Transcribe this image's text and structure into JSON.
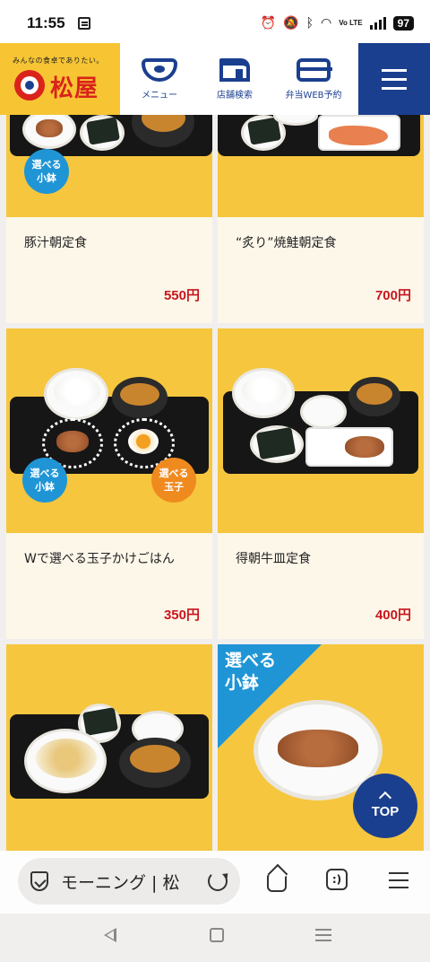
{
  "status_bar": {
    "time": "11:55",
    "battery": "97",
    "network": "Vo LTE"
  },
  "header": {
    "tagline": "みんなの食卓でありたい。",
    "logo_text": "松屋",
    "nav": [
      {
        "label": "メニュー",
        "icon": "bowl-icon"
      },
      {
        "label": "店舗検索",
        "icon": "store-icon"
      },
      {
        "label": "弁当WEB予約",
        "icon": "bento-box-icon"
      }
    ],
    "menu_icon": "hamburger-icon"
  },
  "products": [
    {
      "name": "豚汁朝定食",
      "price": "550円",
      "badge": "選べる\n小鉢"
    },
    {
      "name": "“炙り”焼鮭朝定食",
      "price": "700円"
    },
    {
      "name": "Wで選べる玉子かけごはん",
      "price": "350円",
      "badges": [
        "選べる\n小鉢",
        "選べる\n玉子"
      ]
    },
    {
      "name": "得朝牛皿定食",
      "price": "400円"
    },
    {
      "name": "",
      "price": ""
    },
    {
      "name": "",
      "price": "",
      "ribbon": "選べる\n小鉢"
    }
  ],
  "top_button": {
    "label": "TOP"
  },
  "browser": {
    "url_text": "モーニング | 松"
  },
  "colors": {
    "brand_yellow": "#f7c534",
    "brand_navy": "#1b3f8f",
    "price_red": "#c8161d",
    "badge_blue": "#1f95d6",
    "badge_orange": "#ef8a1f"
  }
}
